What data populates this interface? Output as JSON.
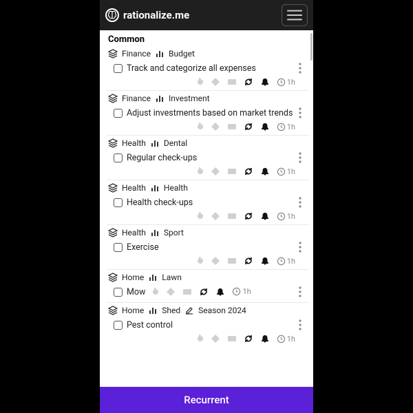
{
  "brand": "rationalize.me",
  "section_title": "Common",
  "bottom_button": "Recurrent",
  "tasks": [
    {
      "cat1": "Finance",
      "cat2": "Budget",
      "title": "Track and categorize all expenses",
      "duration": "1h"
    },
    {
      "cat1": "Finance",
      "cat2": "Investment",
      "title": "Adjust investments based on market trends",
      "duration": "1h"
    },
    {
      "cat1": "Health",
      "cat2": "Dental",
      "title": "Regular check-ups",
      "duration": "1h"
    },
    {
      "cat1": "Health",
      "cat2": "Health",
      "title": "Health check-ups",
      "duration": "1h"
    },
    {
      "cat1": "Health",
      "cat2": "Sport",
      "title": "Exercise",
      "duration": "1h"
    },
    {
      "cat1": "Home",
      "cat2": "Lawn",
      "title": "Mow",
      "duration": "1h",
      "inline_meta": true
    },
    {
      "cat1": "Home",
      "cat2": "Shed",
      "title": "Pest control",
      "duration": "1h",
      "edit": true,
      "extra": "Season 2024"
    }
  ]
}
